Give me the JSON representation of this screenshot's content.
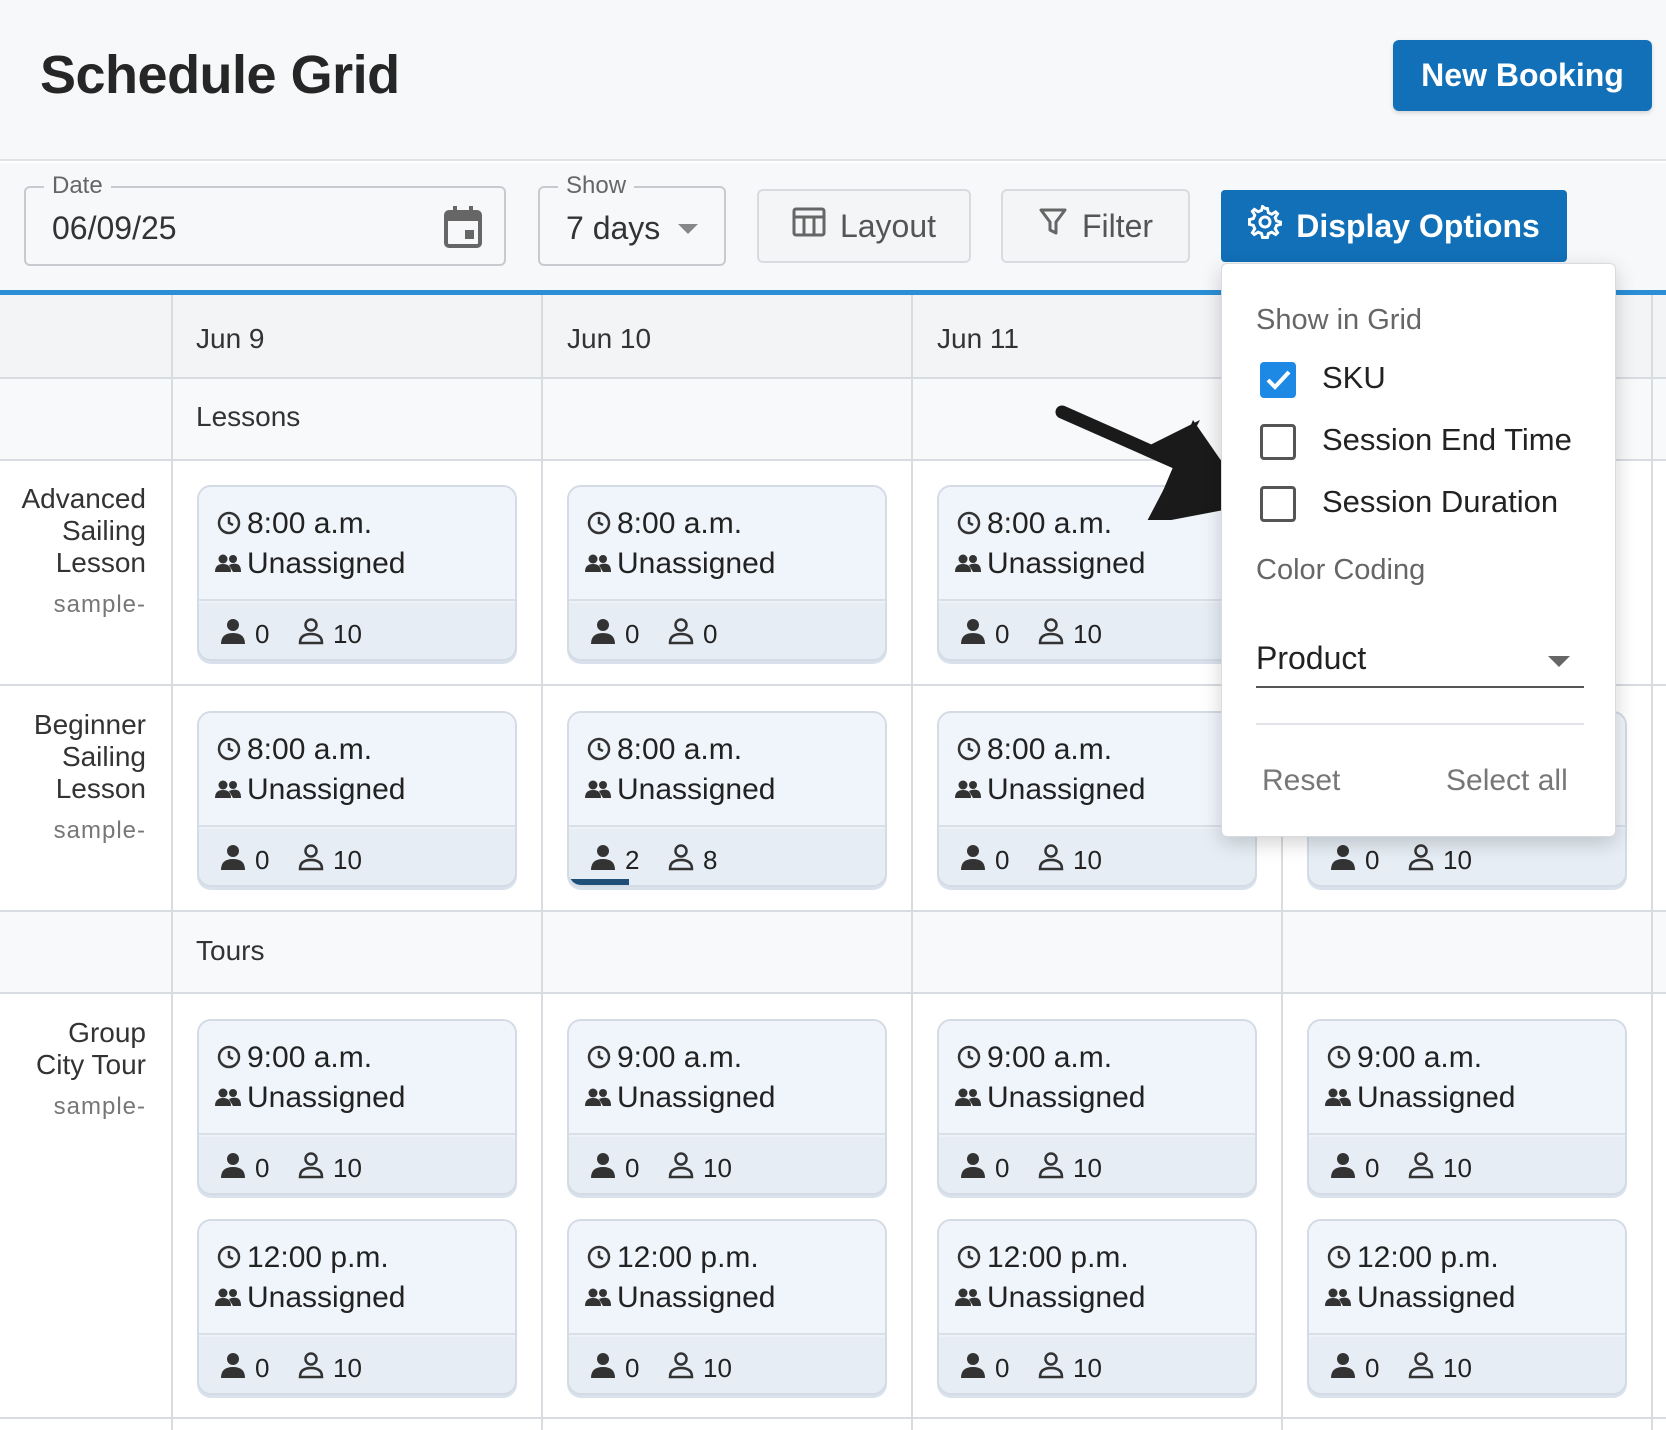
{
  "header": {
    "title": "Schedule Grid",
    "new_booking_label": "New Booking"
  },
  "toolbar": {
    "date": {
      "legend": "Date",
      "value": "06/09/25"
    },
    "show": {
      "legend": "Show",
      "value": "7 days"
    },
    "layout_label": "Layout",
    "filter_label": "Filter",
    "display_options_label": "Display Options"
  },
  "grid": {
    "dates": [
      "Jun 9",
      "Jun 10",
      "Jun 11"
    ],
    "sections": [
      {
        "label": "Lessons",
        "rows": [
          {
            "name_lines": [
              "Advanced",
              "Sailing",
              "Lesson"
            ],
            "sku": "sample-",
            "slots": [
              [
                {
                  "time": "8:00 a.m.",
                  "staff": "Unassigned",
                  "booked": "0",
                  "available": "10"
                },
                {
                  "time": "8:00 a.m.",
                  "staff": "Unassigned",
                  "booked": "0",
                  "available": "0"
                },
                {
                  "time": "8:00 a.m.",
                  "staff": "Unassigned",
                  "booked": "0",
                  "available": "10"
                }
              ]
            ]
          },
          {
            "name_lines": [
              "Beginner",
              "Sailing",
              "Lesson"
            ],
            "sku": "sample-",
            "slots": [
              [
                {
                  "time": "8:00 a.m.",
                  "staff": "Unassigned",
                  "booked": "0",
                  "available": "10"
                },
                {
                  "time": "8:00 a.m.",
                  "staff": "Unassigned",
                  "booked": "2",
                  "available": "8",
                  "fill": 0.2
                },
                {
                  "time": "8:00 a.m.",
                  "staff": "Unassigned",
                  "booked": "0",
                  "available": "10"
                },
                {
                  "booked": "0",
                  "available": "10"
                }
              ]
            ]
          }
        ]
      },
      {
        "label": "Tours",
        "rows": [
          {
            "name_lines": [
              "Group",
              "City Tour"
            ],
            "sku": "sample-",
            "slots": [
              [
                {
                  "time": "9:00 a.m.",
                  "staff": "Unassigned",
                  "booked": "0",
                  "available": "10"
                },
                {
                  "time": "9:00 a.m.",
                  "staff": "Unassigned",
                  "booked": "0",
                  "available": "10"
                },
                {
                  "time": "9:00 a.m.",
                  "staff": "Unassigned",
                  "booked": "0",
                  "available": "10"
                },
                {
                  "time": "9:00 a.m.",
                  "staff": "Unassigned",
                  "booked": "0",
                  "available": "10"
                }
              ],
              [
                {
                  "time": "12:00 p.m.",
                  "staff": "Unassigned",
                  "booked": "0",
                  "available": "10"
                },
                {
                  "time": "12:00 p.m.",
                  "staff": "Unassigned",
                  "booked": "0",
                  "available": "10"
                },
                {
                  "time": "12:00 p.m.",
                  "staff": "Unassigned",
                  "booked": "0",
                  "available": "10"
                },
                {
                  "time": "12:00 p.m.",
                  "staff": "Unassigned",
                  "booked": "0",
                  "available": "10"
                }
              ]
            ]
          }
        ]
      }
    ]
  },
  "display_options": {
    "show_in_grid_heading": "Show in Grid",
    "options": [
      {
        "label": "SKU",
        "checked": true
      },
      {
        "label": "Session End Time",
        "checked": false
      },
      {
        "label": "Session Duration",
        "checked": false
      }
    ],
    "color_coding_heading": "Color Coding",
    "color_coding_value": "Product",
    "reset_label": "Reset",
    "select_all_label": "Select all"
  },
  "colors": {
    "primary": "#1170b8",
    "accent_line": "#2a8fd6",
    "checkbox": "#1e88e5",
    "progress": "#1f4e79"
  },
  "icons": [
    "calendar-icon",
    "layout-icon",
    "filter-icon",
    "gear-icon",
    "clock-icon",
    "group-icon",
    "person-filled-icon",
    "person-outline-icon",
    "annotation-arrow"
  ]
}
